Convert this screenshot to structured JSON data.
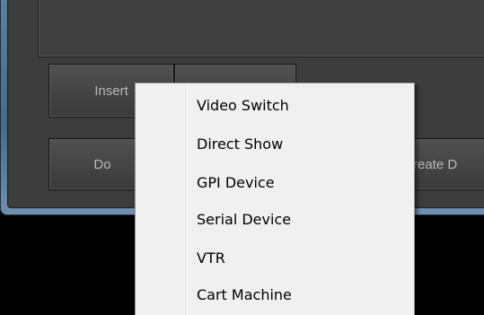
{
  "window": {
    "buttons": {
      "insert_label": "Insert",
      "second_label": "",
      "do_label": "Do",
      "create_label": "reate D"
    }
  },
  "context_menu": {
    "items": [
      {
        "label": "Video Switch"
      },
      {
        "label": "Direct Show"
      },
      {
        "label": "GPI Device"
      },
      {
        "label": "Serial Device"
      },
      {
        "label": "VTR"
      },
      {
        "label": "Cart Machine"
      }
    ]
  },
  "colors": {
    "window_border": "#4a6a8c",
    "client_background": "#3c3c3c",
    "button_text": "#b8b8b8",
    "menu_background": "#f0f0f0",
    "menu_text": "#000000"
  }
}
